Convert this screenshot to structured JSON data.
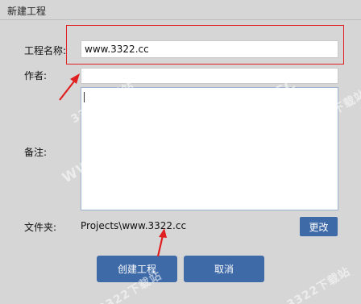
{
  "dialog": {
    "title": "新建工程"
  },
  "form": {
    "name_label": "工程名称:",
    "name_value": "www.3322.cc",
    "author_label": "作者:",
    "author_value": "",
    "notes_label": "备注:",
    "notes_value": "",
    "folder_label": "文件夹:",
    "folder_path": "Projects\\www.3322.cc"
  },
  "buttons": {
    "change_label": "更改",
    "create_label": "创建工程",
    "cancel_label": "取消"
  },
  "watermarks": [
    "WWW.3322.CC",
    "3322下载站",
    "3322下载站",
    "WWW.3322.CC",
    "3322下载站",
    "3322下载站"
  ],
  "colors": {
    "button_bg": "#3f6aa8",
    "highlight": "#e02020",
    "background": "#d6d6d6"
  }
}
